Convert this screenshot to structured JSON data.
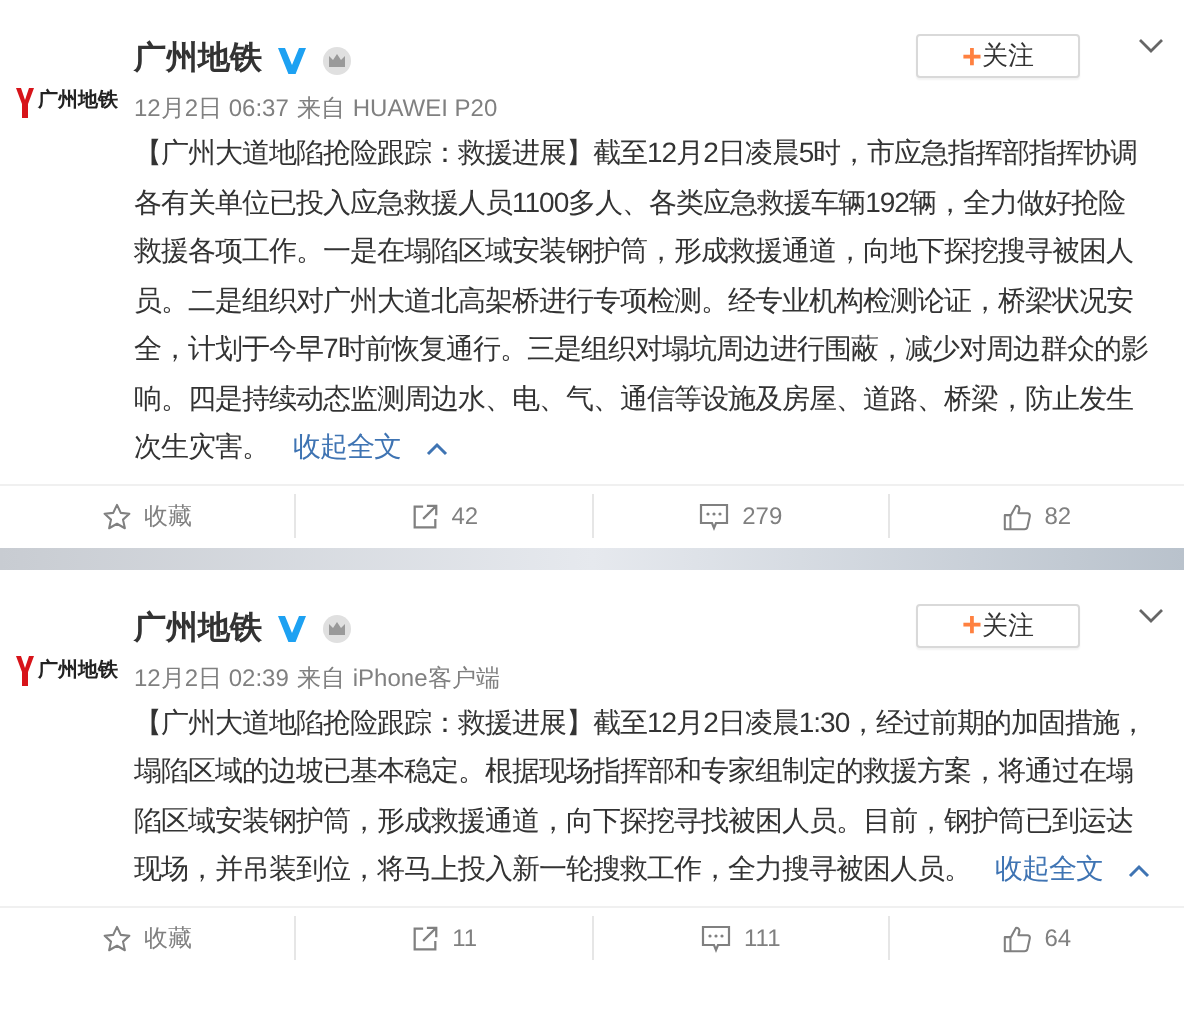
{
  "posts": [
    {
      "logo_text": "广州地铁",
      "name": "广州地铁",
      "verified": true,
      "follow_button": {
        "plus": "+",
        "label": "关注"
      },
      "time": "12月2日 06:37",
      "source_prefix": "来自",
      "source": "HUAWEI P20",
      "text": "【广州大道地陷抢险跟踪：救援进展】截至12月2日凌晨5时，市应急指挥部指挥协调各有关单位已投入应急救援人员1100多人、各类应急救援车辆192辆，全力做好抢险救援各项工作。一是在塌陷区域安装钢护筒，形成救援通道，向地下探挖搜寻被困人员。二是组织对广州大道北高架桥进行专项检测。经专业机构检测论证，桥梁状况安全，计划于今早7时前恢复通行。三是组织对塌坑周边进行围蔽，减少对周边群众的影响。四是持续动态监测周边水、电、气、通信等设施及房屋、道路、桥梁，防止发生次生灾害。",
      "collapse_link": "收起全文",
      "actions": [
        {
          "kind": "favorite",
          "label": "收藏"
        },
        {
          "kind": "repost",
          "label": "42"
        },
        {
          "kind": "comment",
          "label": "279"
        },
        {
          "kind": "like",
          "label": "82"
        }
      ]
    },
    {
      "logo_text": "广州地铁",
      "name": "广州地铁",
      "verified": true,
      "follow_button": {
        "plus": "+",
        "label": "关注"
      },
      "time": "12月2日 02:39",
      "source_prefix": "来自",
      "source": "iPhone客户端",
      "text": "【广州大道地陷抢险跟踪：救援进展】截至12月2日凌晨1:30，经过前期的加固措施，塌陷区域的边坡已基本稳定。根据现场指挥部和专家组制定的救援方案，将通过在塌陷区域安装钢护筒，形成救援通道，向下探挖寻找被困人员。目前，钢护筒已到运达现场，并吊装到位，将马上投入新一轮搜救工作，全力搜寻被困人员。",
      "collapse_link": "收起全文",
      "actions": [
        {
          "kind": "favorite",
          "label": "收藏"
        },
        {
          "kind": "repost",
          "label": "11"
        },
        {
          "kind": "comment",
          "label": "111"
        },
        {
          "kind": "like",
          "label": "64"
        }
      ]
    }
  ]
}
